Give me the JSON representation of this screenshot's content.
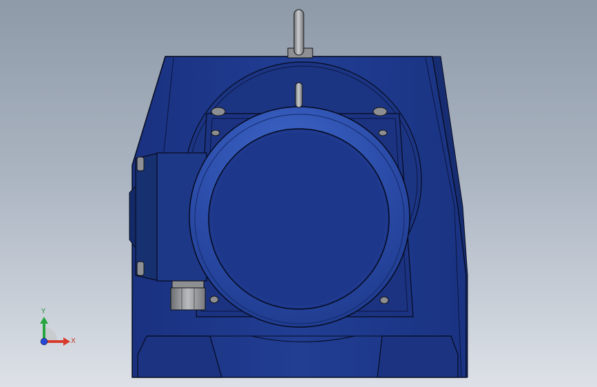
{
  "triad": {
    "y_label": "Y",
    "x_label": "X"
  },
  "colors": {
    "background_top": "#8f9aa9",
    "background_bottom": "#dde1e7",
    "housing_blue": "#1f3a8a",
    "housing_dark": "#162c6e",
    "ring_blue": "#2f54b3",
    "motor_face": "#1d378a",
    "edge": "#050a1e",
    "steel": "#9a9ca0",
    "triad_x": "#d83a2c",
    "triad_y": "#27a640",
    "triad_z": "#2549d6"
  },
  "icons": {
    "triad": "coordinate-triad-icon"
  }
}
